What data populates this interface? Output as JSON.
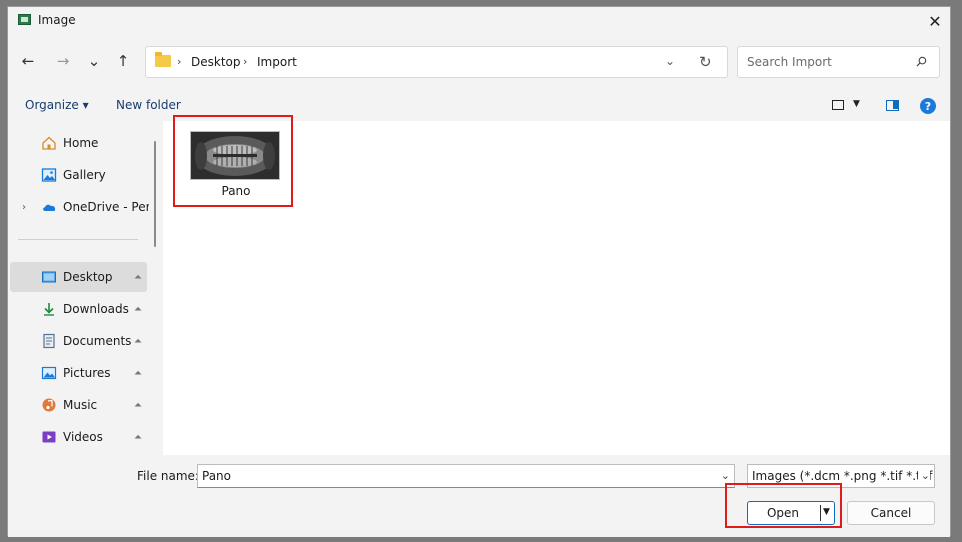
{
  "window": {
    "title": "Image",
    "close_glyph": "✕"
  },
  "nav": {
    "back_glyph": "←",
    "forward_glyph": "→",
    "recent_glyph": "⌄",
    "up_glyph": "↑",
    "breadcrumb": [
      "Desktop",
      "Import"
    ],
    "separator": "›",
    "dropdown_glyph": "⌄",
    "refresh_glyph": "↻",
    "search_placeholder": "Search Import"
  },
  "commands": {
    "organize": "Organize ▾",
    "new_folder": "New folder",
    "view_dropdown": "▼",
    "help": "?"
  },
  "sidebar": {
    "items": [
      {
        "label": "Home",
        "icon": "home-icon",
        "pinned": false
      },
      {
        "label": "Gallery",
        "icon": "gallery-icon",
        "pinned": false
      },
      {
        "label": "OneDrive - Personal",
        "icon": "onedrive-icon",
        "pinned": false,
        "expandable": true
      },
      {
        "label": "Desktop",
        "icon": "desktop-icon",
        "pinned": true,
        "selected": true
      },
      {
        "label": "Downloads",
        "icon": "downloads-icon",
        "pinned": true
      },
      {
        "label": "Documents",
        "icon": "documents-icon",
        "pinned": true
      },
      {
        "label": "Pictures",
        "icon": "pictures-icon",
        "pinned": true
      },
      {
        "label": "Music",
        "icon": "music-icon",
        "pinned": true
      },
      {
        "label": "Videos",
        "icon": "videos-icon",
        "pinned": true
      }
    ],
    "expand_glyph": "›",
    "pin_glyph": "📌"
  },
  "files": [
    {
      "name": "Pano",
      "kind": "panoramic dental x-ray thumbnail"
    }
  ],
  "footer": {
    "file_name_label": "File name:",
    "file_name_value": "Pano",
    "dropdown_glyph": "⌄",
    "file_type_value": "Images (*.dcm *.png *.tif *.tiff *",
    "open_label": "Open",
    "open_dd_glyph": "▼",
    "cancel_label": "Cancel"
  },
  "colors": {
    "highlight": "#e01b1b",
    "accent": "#0f6cbd"
  }
}
